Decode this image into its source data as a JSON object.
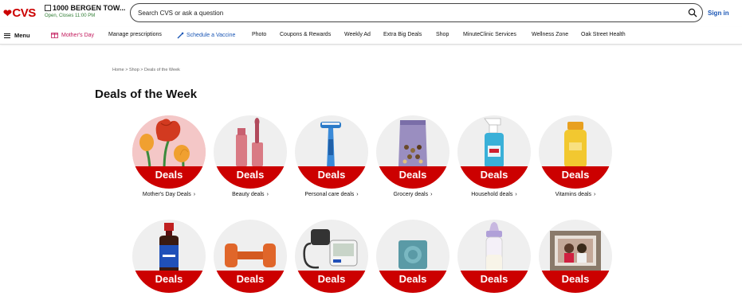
{
  "header": {
    "logo_text": "CVS",
    "store_name": "1000 BERGEN TOW...",
    "store_hours": "Open, Closes 11:00 PM",
    "search_placeholder": "Search CVS or ask a question",
    "signin_label": "Sign in"
  },
  "nav": {
    "menu_label": "Menu",
    "items": [
      "Mother's Day",
      "Manage prescriptions",
      "Schedule a Vaccine",
      "Photo",
      "Coupons & Rewards",
      "Weekly Ad",
      "Extra Big Deals",
      "Shop",
      "MinuteClinic Services",
      "Wellness Zone",
      "Oak Street Health"
    ]
  },
  "breadcrumb": "Home  >  Shop  >  Deals of the Week",
  "page_title": "Deals of the Week",
  "badge_text": "Deals",
  "tiles": [
    {
      "label": "Mother's Day Deals",
      "icon": "tulips-icon"
    },
    {
      "label": "Beauty deals",
      "icon": "lipgloss-icon"
    },
    {
      "label": "Personal care deals",
      "icon": "razor-icon"
    },
    {
      "label": "Grocery deals",
      "icon": "snack-bag-icon"
    },
    {
      "label": "Household deals",
      "icon": "spray-bottle-icon"
    },
    {
      "label": "Vitamins deals",
      "icon": "vitamin-bottle-icon"
    },
    {
      "label": "",
      "icon": "medicine-bottle-icon"
    },
    {
      "label": "",
      "icon": "dumbbell-icon"
    },
    {
      "label": "",
      "icon": "blood-pressure-monitor-icon"
    },
    {
      "label": "",
      "icon": "condom-icon"
    },
    {
      "label": "",
      "icon": "baby-bottle-icon"
    },
    {
      "label": "",
      "icon": "photo-frame-icon"
    }
  ],
  "colors": {
    "brand_red": "#cc0000",
    "link_blue": "#1a56b5",
    "mothers_day_pink": "#c2185b",
    "open_green": "#2e7d32"
  }
}
